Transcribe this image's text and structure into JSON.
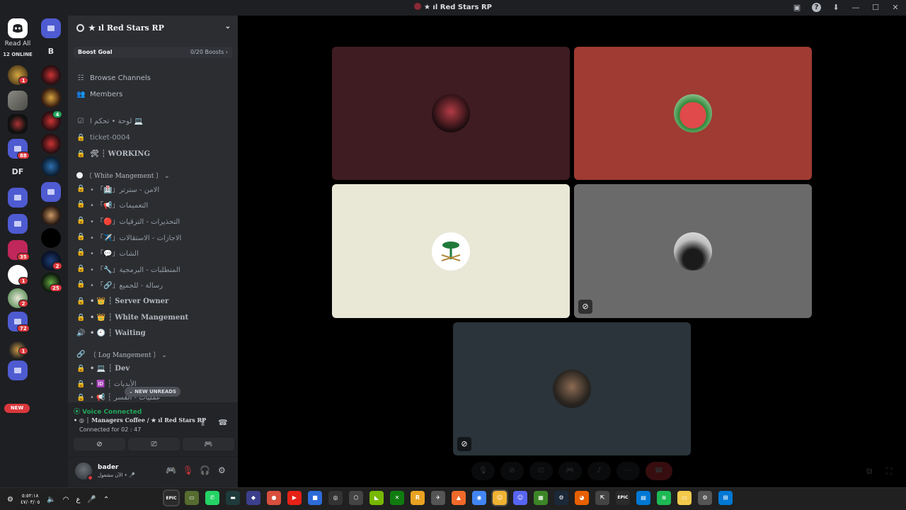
{
  "window": {
    "title": "★ ıl Red Stars RP"
  },
  "rail": {
    "read_all": "Read All",
    "online": "12 ONLINE",
    "letter_b": "B",
    "letter_df": "DF",
    "new_label": "NEW",
    "badges": {
      "a": "1",
      "b": "88",
      "c": "35",
      "d": "1",
      "e": "2",
      "f": "72",
      "g": "1",
      "r2a": "4",
      "r2b": "2",
      "r2c": "25"
    }
  },
  "server": {
    "name": "★ ıl Red Stars RP",
    "boost_goal": "Boost Goal",
    "boost_count": "0/20 Boosts",
    "boost_arrow": "›"
  },
  "channels": {
    "browse": "Browse Channels",
    "members": "Members",
    "items": [
      {
        "icon": "☑",
        "label": "لوحة • تحكم ا 💻"
      },
      {
        "icon": "🔒",
        "label": "ticket-0004"
      },
      {
        "icon": "🔒",
        "label": "🛠 ┆ WORKING"
      },
      {
        "icon": "",
        "label": "〔 White Mangement 〕 ⌄"
      },
      {
        "icon": "🔒",
        "label": "• 「🏥」الامن - سترتر"
      },
      {
        "icon": "🔒",
        "label": "• 「📢」التعميمات"
      },
      {
        "icon": "🔒",
        "label": "• 「🔴」التحذيرات - الترقيات"
      },
      {
        "icon": "🔒",
        "label": "• 「✈️」الاجازات - الاستقالات"
      },
      {
        "icon": "🔒",
        "label": "• 「💬」الشات"
      },
      {
        "icon": "🔒",
        "label": "• 「🔧」المتطلبات - البرمجية"
      },
      {
        "icon": "🔒",
        "label": "• 「🔗」رسالة - للجميع"
      },
      {
        "icon": "🔒",
        "label": "• 👑 ┆ Server Owner"
      },
      {
        "icon": "🔒",
        "label": "• 👑 ┆ White Mangement"
      },
      {
        "icon": "🔊",
        "label": "• 🕘 ┆ Waiting"
      },
      {
        "icon": "🔗",
        "label": "〔 Log Mangement 〕 ⌄"
      },
      {
        "icon": "🔒",
        "label": "• 💻 ┆ Dev"
      },
      {
        "icon": "🔒",
        "label": "• 🆔 ┆ الأيديات"
      },
      {
        "icon": "🔒",
        "label": "• 📢 ┆ عمليات - الفسر"
      }
    ],
    "new_unreads": "⌄ NEW UNREADS"
  },
  "voice": {
    "status": "Voice Connected",
    "channel": "• ◎ ┆ Managers Coffee / ★ ıl Red Stars RP",
    "connected_for": "Connected for 02 : 47",
    "buttons": [
      "camera-off",
      "screen-share",
      "activities",
      "soundboard"
    ]
  },
  "user": {
    "name": "bader",
    "status": "الآن مشغول • 🎤"
  },
  "tiles": [
    {
      "name": "tile-red-stars",
      "bg": "#3e1c22"
    },
    {
      "name": "tile-watermelon",
      "bg": "#9f3b32"
    },
    {
      "name": "tile-saudi-emblem",
      "bg": "#e9e8d7"
    },
    {
      "name": "tile-grey-user",
      "bg": "#6a6a6a"
    },
    {
      "name": "tile-viking",
      "bg": "#2a343a"
    }
  ],
  "taskbar": {
    "time": "٥:٥٢:١٨",
    "date": "٤٧/٠٣/٠٥",
    "lang": "ع",
    "epic_label": "EPIC"
  }
}
